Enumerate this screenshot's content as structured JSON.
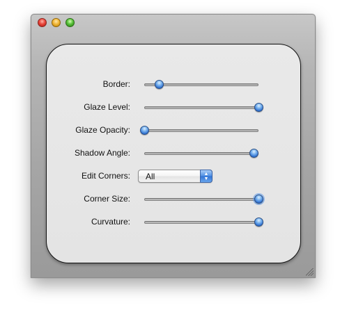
{
  "window": {
    "buttons": [
      "close",
      "minimize",
      "zoom"
    ]
  },
  "controls": {
    "border": {
      "label": "Border:",
      "value": 0.13
    },
    "glaze_level": {
      "label": "Glaze Level:",
      "value": 1.0
    },
    "glaze_opacity": {
      "label": "Glaze Opacity:",
      "value": 0.0
    },
    "shadow_angle": {
      "label": "Shadow Angle:",
      "value": 0.96
    },
    "edit_corners": {
      "label": "Edit Corners:",
      "selected": "All"
    },
    "corner_size": {
      "label": "Corner Size:",
      "value": 1.0,
      "focused": true
    },
    "curvature": {
      "label": "Curvature:",
      "value": 1.0
    }
  },
  "colors": {
    "slider_thumb": "#3b7ddc",
    "panel_bg": "#e6e6e6",
    "window_bg": "#a8a8a8",
    "popup_arrow": "#3d7fdb"
  },
  "icons": {
    "popup": "updown-arrows-icon",
    "resize": "resize-grip-icon"
  }
}
